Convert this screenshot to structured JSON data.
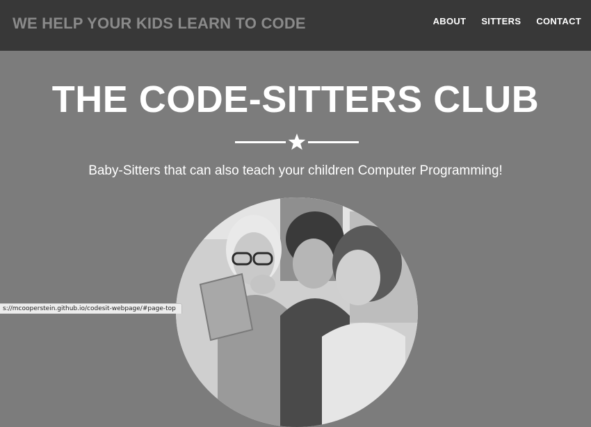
{
  "navbar": {
    "brand": "WE HELP YOUR KIDS LEARN TO CODE",
    "links": [
      {
        "label": "ABOUT"
      },
      {
        "label": "SITTERS"
      },
      {
        "label": "CONTACT"
      }
    ]
  },
  "hero": {
    "title": "THE CODE-SITTERS CLUB",
    "divider_icon": "star-icon",
    "subtitle": "Baby-Sitters that can also teach your children Computer Programming!"
  },
  "status_bar": {
    "url": "s://mcooperstein.github.io/codesit-webpage/#page-top"
  }
}
